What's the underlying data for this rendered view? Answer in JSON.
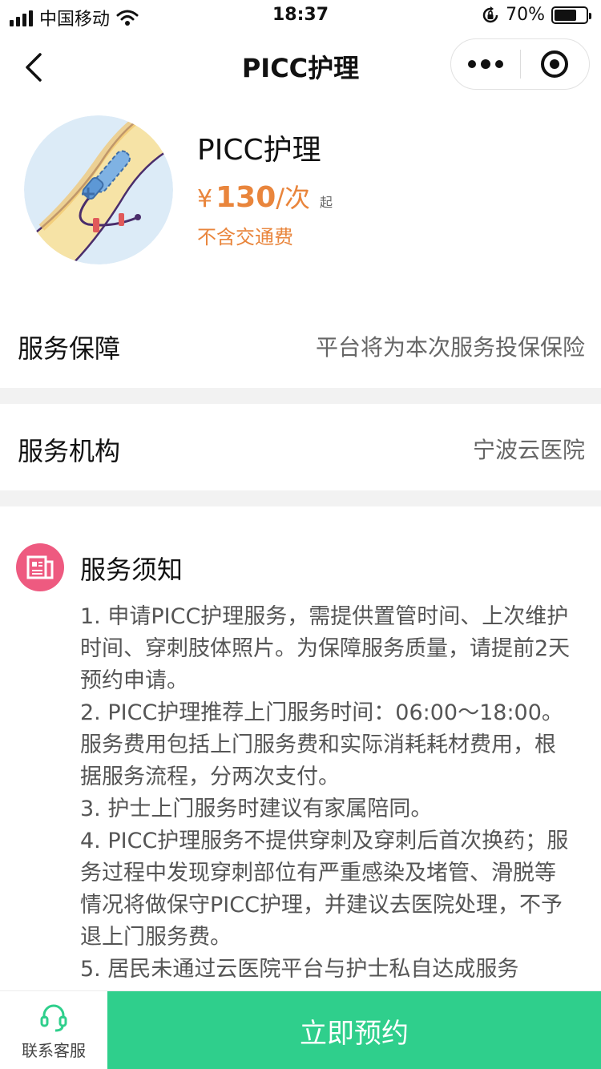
{
  "status_bar": {
    "carrier": "中国移动",
    "time": "18:37",
    "battery_percent": "70%",
    "battery_level": 0.7,
    "icons": [
      "signal-icon",
      "wifi-icon",
      "rotation-lock-icon",
      "battery-icon"
    ]
  },
  "nav": {
    "title": "PICC护理",
    "icons": [
      "back-arrow-icon",
      "more-dots-icon",
      "close-target-icon"
    ]
  },
  "product": {
    "name": "PICC护理",
    "currency": "¥",
    "price": "130",
    "unit": "/次",
    "from_label": "起",
    "note": "不含交通费",
    "image_icon": "picc-arm-illustration"
  },
  "rows": [
    {
      "label": "服务保障",
      "value": "平台将为本次服务投保保险"
    },
    {
      "label": "服务机构",
      "value": "宁波云医院"
    }
  ],
  "notice": {
    "title": "服务须知",
    "icon": "notice-document-icon",
    "items": [
      "1. 申请PICC护理服务，需提供置管时间、上次维护时间、穿刺肢体照片。为保障服务质量，请提前2天预约申请。",
      "2. PICC护理推荐上门服务时间：06:00～18:00。服务费用包括上门服务费和实际消耗耗材费用，根据服务流程，分两次支付。",
      "3. 护士上门服务时建议有家属陪同。",
      "4. PICC护理服务不提供穿刺及穿刺后首次换药；服务过程中发现穿刺部位有严重感染及堵管、滑脱等情况将做保守PICC护理，并建议去医院处理，不予退上门服务费。",
      "5. 居民未通过云医院平台与护士私自达成服务"
    ]
  },
  "bottom": {
    "customer_service_label": "联系客服",
    "customer_service_icon": "headset-icon",
    "book_label": "立即预约"
  },
  "colors": {
    "accent_green": "#2fcf8c",
    "price_orange": "#e9853c",
    "notice_icon_pink": "#ee5a80"
  }
}
